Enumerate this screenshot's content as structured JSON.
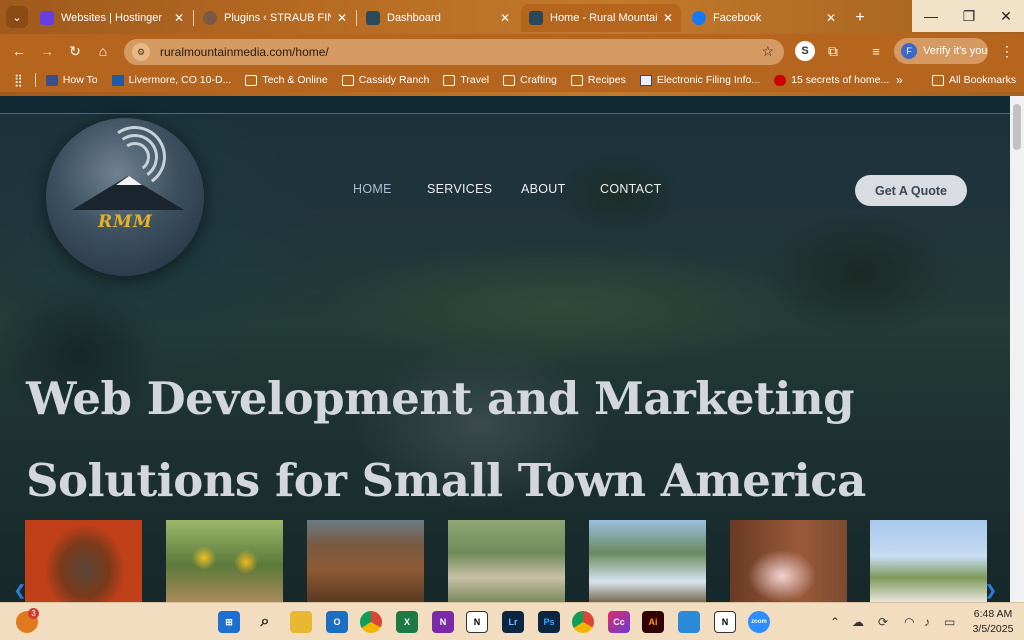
{
  "browser": {
    "tabs": [
      {
        "title": "Websites | Hostinger",
        "close": "✕"
      },
      {
        "title": "Plugins ‹ STRAUB FINE FI",
        "close": "✕"
      },
      {
        "title": "Dashboard",
        "close": "✕"
      },
      {
        "title": "Home - Rural Mountain M",
        "close": "✕"
      },
      {
        "title": "Facebook",
        "close": "✕"
      }
    ],
    "new_tab": "+",
    "url": "ruralmountainmedia.com/home/",
    "verify_label": "Verify it's you",
    "profile_initial": "F",
    "bookmarks": [
      {
        "label": "How To"
      },
      {
        "label": "Livermore, CO 10-D..."
      },
      {
        "label": "Tech & Online"
      },
      {
        "label": "Cassidy Ranch"
      },
      {
        "label": "Travel"
      },
      {
        "label": "Crafting"
      },
      {
        "label": "Recipes"
      },
      {
        "label": "Electronic Filing Info..."
      },
      {
        "label": "15 secrets of home..."
      }
    ],
    "overflow": "»",
    "all_bookmarks": "All Bookmarks"
  },
  "site": {
    "logo_text": "RMM",
    "nav": [
      {
        "label": "HOME"
      },
      {
        "label": "SERVICES"
      },
      {
        "label": "ABOUT"
      },
      {
        "label": "CONTACT"
      }
    ],
    "cta": "Get A Quote",
    "hero_line1": "Web Development and Marketing",
    "hero_line2": "Solutions for Small Town America",
    "gallery_count": 7
  },
  "taskbar": {
    "notif_badge": "3",
    "time": "6:48 AM",
    "date": "3/5/2025"
  },
  "colors": {
    "chrome": "#b5651d",
    "accent_cta": "#d9dde2",
    "hero_text": "#d3d6db",
    "logo_gold": "#e3b127"
  }
}
